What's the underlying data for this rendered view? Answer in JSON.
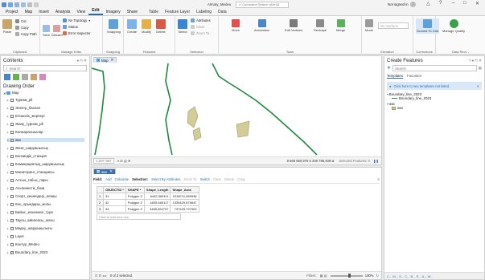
{
  "titlebar": {
    "title": "Almaty_Medeu",
    "search_placeholder": "Command Search (Alt+Q)",
    "signin": "Not signed in",
    "controls": [
      "?",
      "–",
      "□",
      "✕"
    ]
  },
  "menu": {
    "items": [
      "Project",
      "Map",
      "Insert",
      "Analysis",
      "View",
      "Edit",
      "Imagery",
      "Share",
      "Table",
      "Feature Layer",
      "Labeling",
      "Data"
    ],
    "active": "Edit"
  },
  "ribbon": {
    "clipboard": {
      "label": "Clipboard",
      "paste": "Paste",
      "cut": "Cut",
      "copy": "Copy",
      "copy_path": "Copy Path"
    },
    "manage_edits": {
      "label": "Manage Edits",
      "no_topology": "No Topology",
      "save": "Save",
      "discard": "Discard",
      "status": "Status",
      "error_inspector": "Error Inspector"
    },
    "snapping": {
      "label": "Snapping",
      "btn": "Snapping"
    },
    "features": {
      "label": "Features",
      "create": "Create",
      "modify": "Modify",
      "delete": "Delete"
    },
    "selection": {
      "label": "Selection",
      "select": "Select",
      "attributes": "Attributes",
      "clear": "Clear",
      "zoom_to": "Zoom To"
    },
    "tools": {
      "label": "Tools",
      "move": "Move",
      "annotation": "Annotation",
      "edit_vertices": "Edit Vertices",
      "reshape": "Reshape",
      "merge": "Merge"
    },
    "elevation": {
      "label": "Elevation",
      "mode": "Mode",
      "value": "No Surface"
    },
    "corrections": {
      "label": "Corrections",
      "ground": "Ground To Grid"
    },
    "data_review": {
      "label": "Data Revi...",
      "manage_quality": "Manage Quality"
    }
  },
  "contents": {
    "title": "Contents",
    "search_placeholder": "Search",
    "drawing_order": "Drawing Order",
    "map_label": "Map",
    "layers": [
      {
        "name": "Туризм_pll",
        "checked": false
      },
      {
        "name": "Электр_баспал",
        "checked": false
      },
      {
        "name": "Егіншілік_жерлері",
        "checked": false
      },
      {
        "name": "Жаяу_туризм_pll",
        "checked": false
      },
      {
        "name": "Көлжаралшылар",
        "checked": false
      },
      {
        "name": "жкх",
        "checked": true,
        "selected": true
      },
      {
        "name": "Жеке_шаруашылық",
        "checked": false
      },
      {
        "name": "Бензиндік_станция",
        "checked": false
      },
      {
        "name": "Коммерциялық_шаруашылық",
        "checked": false
      },
      {
        "name": "Мониторинг_станциясы",
        "checked": false
      },
      {
        "name": "Алтын_табыс_пары",
        "checked": false
      },
      {
        "name": "Альпинистік_база",
        "checked": false
      },
      {
        "name": "Спорт_кешендері_алаңы",
        "checked": false
      },
      {
        "name": "Кен_орындары_жолы",
        "checked": false
      },
      {
        "name": "Байыс_кешенкөл_тура",
        "checked": false
      },
      {
        "name": "Таулы_айналасы_жолы",
        "checked": false
      },
      {
        "name": "Медеу_шаруашылығы",
        "checked": false
      },
      {
        "name": "Layer",
        "checked": false
      },
      {
        "name": "Контур_Medeu",
        "checked": false
      },
      {
        "name": "Boundary_line_2023",
        "checked": true
      }
    ]
  },
  "map_view": {
    "tab": "Map",
    "scale": "1:207 987",
    "coords": "8 568 560,976 5 349 786,409 м",
    "selected": "Selected Features: 0"
  },
  "attr_table": {
    "tab": "жкх",
    "toolbar": [
      "Field:",
      "Add",
      "Calculate",
      "Selection:",
      "Select By Attributes",
      "Zoom To",
      "Switch",
      "Clear",
      "Delete",
      "Copy"
    ],
    "columns": [
      "OBJECTID *",
      "SHAPE *",
      "Shape_Length",
      "Shape_Area"
    ],
    "rows": [
      [
        "1",
        "31",
        "Polygon Z",
        "6432,369111",
        "2236711,355538"
      ],
      [
        "2",
        "32",
        "Polygon Z",
        "4839,465117",
        "1339429,875647"
      ],
      [
        "3",
        "33",
        "Polygon Z",
        "3465,562737",
        "737425,797903"
      ]
    ],
    "add_row": "Click to add new row.",
    "status": "0 of 3 selected",
    "filters": "Filters:",
    "zoom": "100%"
  },
  "create_features": {
    "title": "Create Features",
    "search_placeholder": "Search",
    "tabs": [
      "Templates",
      "Favorites"
    ],
    "info": "Click here to see templates not listed.",
    "groups": [
      {
        "name": "Boundary_line_2023",
        "items": [
          "Boundary_line_2023"
        ]
      },
      {
        "name": "жкх",
        "items": [
          "жкх"
        ]
      }
    ],
    "bottom_tabs": "C... M... S... C... B... E... A... W..."
  },
  "colors": {
    "accent": "#2a6fb5",
    "polygon_fill": "#d2cc98",
    "boundary": "#1e8a3c"
  }
}
